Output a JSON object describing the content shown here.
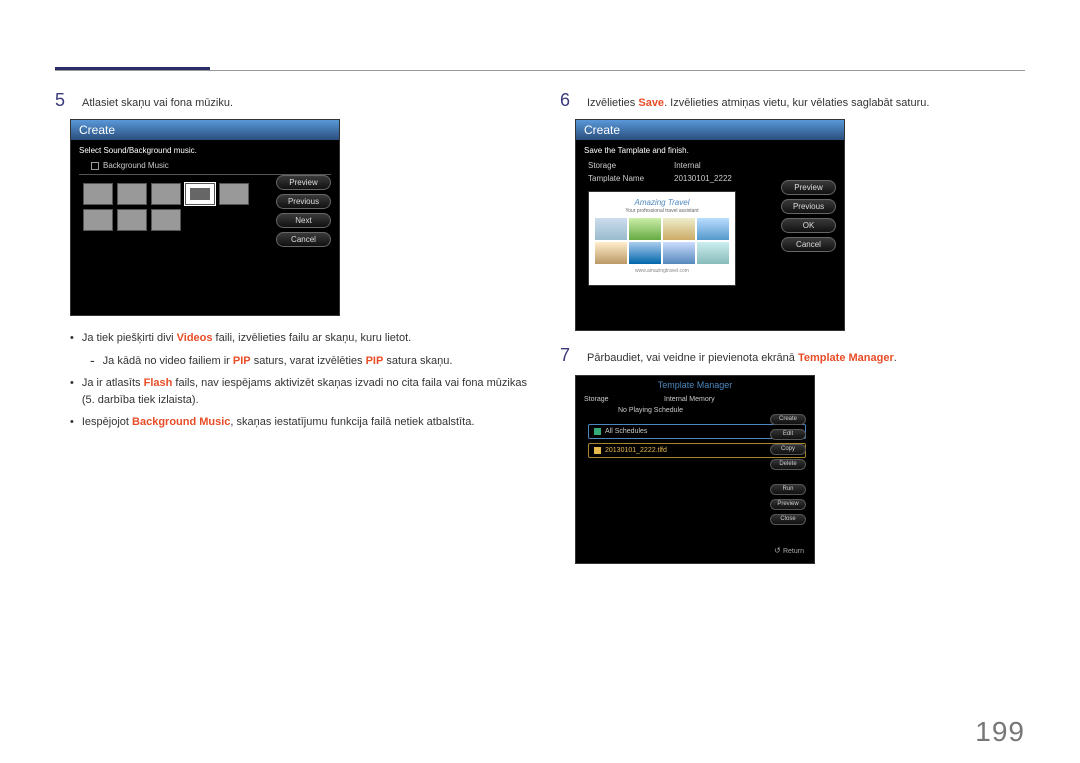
{
  "page_number": "199",
  "step5": {
    "num": "5",
    "text": "Atlasiet skaņu vai fona mūziku.",
    "screen": {
      "title": "Create",
      "instr": "Select Sound/Background music.",
      "bg_music": "Background Music",
      "buttons": {
        "preview": "Preview",
        "previous": "Previous",
        "next": "Next",
        "cancel": "Cancel"
      }
    },
    "bullets": {
      "b1_pre": "Ja tiek piešķirti divi ",
      "b1_hl": "Videos",
      "b1_post": " faili, izvēlieties failu ar skaņu, kuru lietot.",
      "sub_pre": "Ja kādā no video failiem ir ",
      "sub_hl1": "PIP",
      "sub_mid": " saturs, varat izvēlēties ",
      "sub_hl2": "PIP",
      "sub_post": " satura skaņu.",
      "b2_pre": "Ja ir atlasīts ",
      "b2_hl": "Flash",
      "b2_post": " fails, nav iespējams aktivizēt skaņas izvadi no cita faila vai fona mūzikas (5. darbība tiek izlaista).",
      "b3_pre": "Iespējojot ",
      "b3_hl": "Background Music",
      "b3_post": ", skaņas iestatījumu funkcija failā netiek atbalstīta."
    }
  },
  "step6": {
    "num": "6",
    "text_pre": "Izvēlieties ",
    "text_hl": "Save",
    "text_post": ". Izvēlieties atmiņas vietu, kur vēlaties saglabāt saturu.",
    "screen": {
      "title": "Create",
      "instr": "Save the Tamplate and finish.",
      "storage_k": "Storage",
      "storage_v": "Internal",
      "name_k": "Tamplate Name",
      "name_v": "20130101_2222",
      "buttons": {
        "preview": "Preview",
        "previous": "Previous",
        "ok": "OK",
        "cancel": "Cancel"
      },
      "travel": {
        "title": "Amazing Travel",
        "sub": "Your professional travel assistant",
        "foot": "www.amazingtravel.com"
      }
    }
  },
  "step7": {
    "num": "7",
    "text_pre": "Pārbaudiet, vai veidne ir pievienota ekrānā ",
    "text_hl": "Template Manager",
    "text_post": ".",
    "tm": {
      "title": "Template Manager",
      "storage_k": "Storage",
      "storage_v": "Internal Memory",
      "sched": "No Playing Schedule",
      "all": "All Schedules",
      "file": "20130101_2222.tlfd",
      "buttons": {
        "create": "Create",
        "edit": "Edit",
        "copy": "Copy",
        "delete": "Delete",
        "run": "Run",
        "preview": "Preview",
        "close": "Close"
      },
      "return": "Return"
    }
  }
}
